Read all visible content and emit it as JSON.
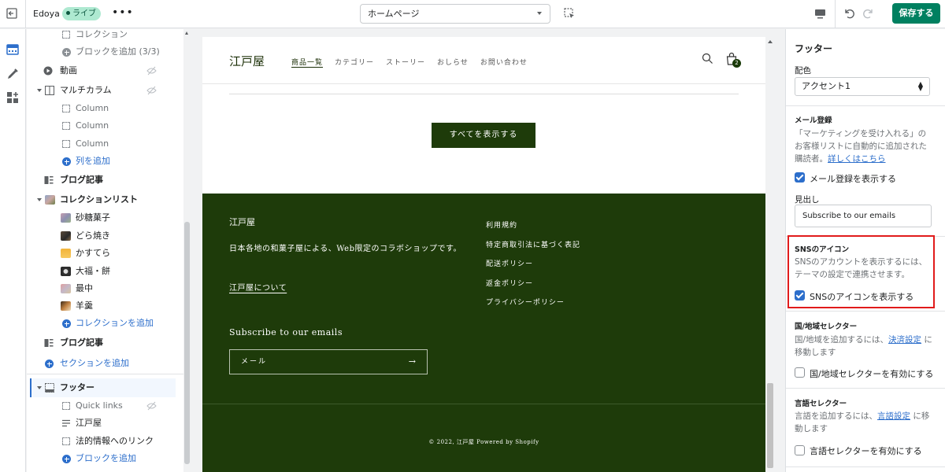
{
  "topbar": {
    "store_name": "Edoya",
    "live_label": "ライブ",
    "more_label": "•••",
    "page_select_value": "ホームページ",
    "save_label": "保存する"
  },
  "sidebar": {
    "items": [
      {
        "label": "コレクション"
      },
      {
        "label": "ブロックを追加 (3/3)"
      },
      {
        "label": "動画"
      },
      {
        "label": "マルチカラム"
      },
      {
        "label": "Column"
      },
      {
        "label": "Column"
      },
      {
        "label": "Column"
      },
      {
        "label": "列を追加"
      },
      {
        "label": "ブログ記事"
      },
      {
        "label": "コレクションリスト"
      },
      {
        "label": "砂糖菓子"
      },
      {
        "label": "どら焼き"
      },
      {
        "label": "かすてら"
      },
      {
        "label": "大福・餅"
      },
      {
        "label": "最中"
      },
      {
        "label": "羊羹"
      },
      {
        "label": "コレクションを追加"
      },
      {
        "label": "ブログ記事"
      },
      {
        "label": "セクションを追加"
      },
      {
        "label": "フッター"
      },
      {
        "label": "Quick links"
      },
      {
        "label": "江戸屋"
      },
      {
        "label": "法的情報へのリンク"
      },
      {
        "label": "ブロックを追加"
      }
    ]
  },
  "store": {
    "logo": "江戸屋",
    "nav": [
      "商品一覧",
      "カテゴリー",
      "ストーリー",
      "おしらせ",
      "お問い合わせ"
    ],
    "cart_count": "2",
    "show_all_label": "すべてを表示する",
    "footer": {
      "brand": "江戸屋",
      "description": "日本各地の和菓子屋による、Web限定のコラボショップです。",
      "about_link": "江戸屋について",
      "links": [
        "利用規約",
        "特定商取引法に基づく表記",
        "配送ポリシー",
        "返金ポリシー",
        "プライバシーポリシー"
      ],
      "subscribe_heading": "Subscribe to our emails",
      "email_placeholder": "メール",
      "arrow": "→",
      "copyright": "© 2022, 江戸屋 Powered by Shopify"
    }
  },
  "panel": {
    "title": "フッター",
    "color_label": "配色",
    "color_value": "アクセント1",
    "email_heading": "メール登録",
    "email_desc": "「マーケティングを受け入れる」のお客様リストに自動的に追加された購読者。",
    "email_link": "詳しくはこちら",
    "email_checkbox": "メール登録を表示する",
    "heading_label": "見出し",
    "heading_value": "Subscribe to our emails",
    "sns_heading": "SNSのアイコン",
    "sns_desc": "SNSのアカウントを表示するには、テーマの設定で連携させます。",
    "sns_checkbox": "SNSのアイコンを表示する",
    "country_heading": "国/地域セレクター",
    "country_desc_pre": "国/地域を追加するには、",
    "country_link": "決済設定",
    "country_desc_post": " に移動します",
    "country_checkbox": "国/地域セレクターを有効にする",
    "lang_heading": "言語セレクター",
    "lang_desc_pre": "言語を追加するには、",
    "lang_link": "言語設定",
    "lang_desc_post": " に移動します",
    "lang_checkbox": "言語セレクターを有効にする"
  },
  "colors": {
    "accent": "#008060",
    "footer_bg": "#1e3b0a",
    "link": "#2c6ecb",
    "highlight": "#e11b1b"
  }
}
